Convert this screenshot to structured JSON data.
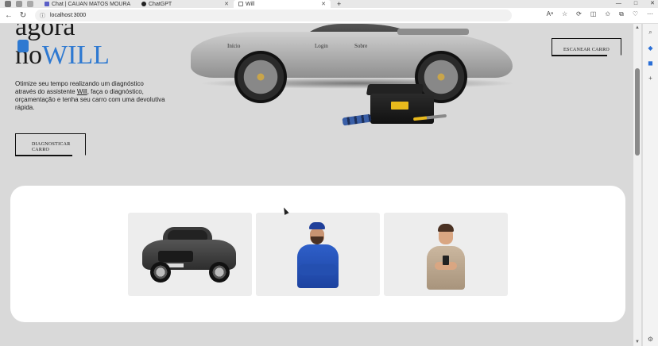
{
  "browser": {
    "tabs": [
      {
        "label": "",
        "favicon": "app-icon"
      },
      {
        "label": "Chat | CAUAN MATOS MOURA",
        "favicon": "teams-icon"
      },
      {
        "label": "ChatGPT",
        "favicon": "chatgpt-icon"
      },
      {
        "label": "Will",
        "favicon": "page-icon",
        "active": true
      }
    ],
    "new_tab": "+",
    "url": "localhost:3000",
    "window_controls": [
      "—",
      "□",
      "✕"
    ]
  },
  "hero": {
    "title_line1": "agora",
    "title_prefix": "no",
    "title_brand": "WILL",
    "description_before": "Otimize seu tempo realizando um diagnóstico através do assistente ",
    "description_link": "Will",
    "description_after": ", faça o diagnóstico, orçamentação e tenha seu carro com uma devolutiva rápida.",
    "diagnose_button": "DIAGNOSTICAR CARRO",
    "scan_button": "ESCANEAR CARRO"
  },
  "car_nav": {
    "items": [
      "Início",
      "Login",
      "Sobre"
    ]
  },
  "cards": [
    {
      "name": "car-card",
      "image": "suv-image"
    },
    {
      "name": "mechanic-card",
      "image": "mechanic-image"
    },
    {
      "name": "customer-card",
      "image": "customer-phone-image"
    }
  ],
  "colors": {
    "brand_blue": "#2e79d1",
    "page_bg": "#d9d9d9",
    "panel_bg": "#ffffff"
  }
}
